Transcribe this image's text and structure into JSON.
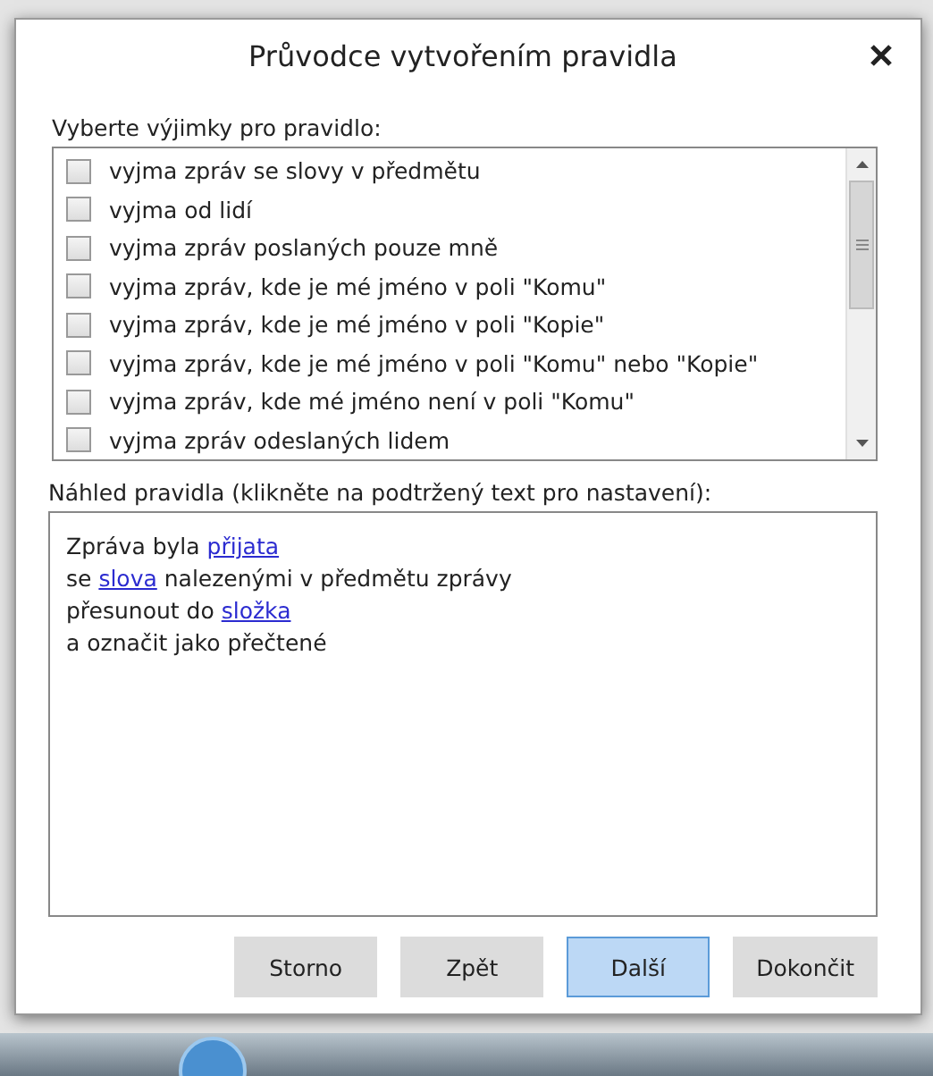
{
  "dialog": {
    "title": "Průvodce vytvořením pravidla"
  },
  "exceptions": {
    "label": "Vyberte výjimky pro pravidlo:",
    "items": [
      {
        "label": "vyjma zpráv se slovy v předmětu",
        "checked": false
      },
      {
        "label": "vyjma od lidí",
        "checked": false
      },
      {
        "label": "vyjma zpráv poslaných pouze mně",
        "checked": false
      },
      {
        "label": "vyjma zpráv, kde je mé jméno v poli \"Komu\"",
        "checked": false
      },
      {
        "label": "vyjma zpráv, kde je mé jméno v poli \"Kopie\"",
        "checked": false
      },
      {
        "label": "vyjma zpráv, kde je mé jméno v poli \"Komu\" nebo \"Kopie\"",
        "checked": false
      },
      {
        "label": "vyjma zpráv, kde mé jméno není v poli \"Komu\"",
        "checked": false
      },
      {
        "label": "vyjma zpráv odeslaných lidem",
        "checked": false
      }
    ]
  },
  "preview": {
    "label": "Náhled pravidla (klikněte na podtržený text pro nastavení):",
    "lines": [
      {
        "segments": [
          {
            "text": "Zpráva byla ",
            "link": false
          },
          {
            "text": "přijata",
            "link": true
          }
        ]
      },
      {
        "segments": [
          {
            "text": "se ",
            "link": false
          },
          {
            "text": "slova",
            "link": true
          },
          {
            "text": " nalezenými v předmětu zprávy",
            "link": false
          }
        ]
      },
      {
        "segments": [
          {
            "text": "přesunout do ",
            "link": false
          },
          {
            "text": "složka",
            "link": true
          }
        ]
      },
      {
        "segments": [
          {
            "text": "a označit jako přečtené",
            "link": false
          }
        ]
      }
    ]
  },
  "buttons": [
    {
      "label": "Storno",
      "focused": false
    },
    {
      "label": "Zpět",
      "focused": false
    },
    {
      "label": "Další",
      "focused": true
    },
    {
      "label": "Dokončit",
      "focused": false
    }
  ]
}
